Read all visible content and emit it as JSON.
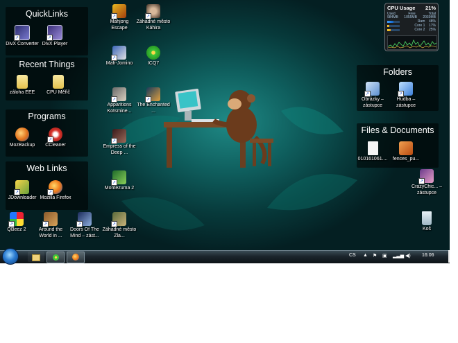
{
  "fences": {
    "quicklinks": "QuickLinks",
    "recent": "Recent Things",
    "programs": "Programs",
    "weblinks": "Web Links",
    "folders": "Folders",
    "files": "Files & Documents"
  },
  "icons": {
    "divx_converter": "DivX Converter",
    "divx_player": "DivX Player",
    "zaloha": "záloha EEE",
    "cpu_meric": "CPU Měřič",
    "mozbackup": "MozBackup",
    "ccleaner": "CCleaner",
    "jdownloader": "JDownloader",
    "firefox": "Mozilla Firefox",
    "qbeez": "QBeez 2",
    "around_world": "Around the World in ...",
    "doors_mind": "Doors Of The Mind – zást...",
    "zahadne_zla": "Záhadné město Zla...",
    "mahjong": "Mahjong Escape",
    "zahadne_kahira": "Záhadné město Káhira",
    "mah_jomino": "Mah-Jomino",
    "icq": "ICQ7",
    "apparitions": "Apparitions Kotsmine...",
    "enchanted": "The Enchanted ...",
    "empress": "Empress of the Deep ...",
    "montezuma": "Montezuma 2",
    "obrazky": "Obrázky – zástupce",
    "hudba": "Hudba – zástupce",
    "file_0101": "010161061....",
    "fences_pu": "fences_pu...",
    "crazychic": "CrazyChic... – zástupce",
    "kos": "Koš"
  },
  "gadget": {
    "title": "CPU Usage",
    "percent": "21%",
    "used_label": "Used",
    "free_label": "Free",
    "total_label": "Total",
    "used_val": "984MB",
    "free_val": "1055MB",
    "total_val": "2039MB",
    "ram_label": "Ram",
    "ram_pct": "48%",
    "ram_level": 0.48,
    "core1_label": "Core 1",
    "core1_pct": "17%",
    "core1_level": 0.17,
    "core2_label": "Core 2",
    "core2_pct": "25%",
    "core2_level": 0.25
  },
  "taskbar": {
    "language": "CS",
    "clock": "16:06"
  }
}
